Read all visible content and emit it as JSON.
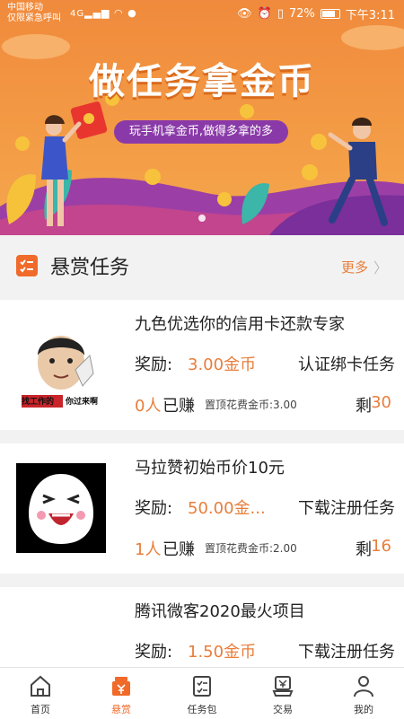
{
  "status_bar": {
    "carrier_line1": "中国移动",
    "carrier_line2": "仅限紧急呼叫",
    "signal_text": "4G",
    "battery": "72%",
    "time": "下午3:11"
  },
  "banner": {
    "title": "做任务拿金币",
    "subtitle": "玩手机拿金币,做得多拿的多"
  },
  "section": {
    "title": "悬赏任务",
    "more_label": "更多"
  },
  "tasks": [
    {
      "title": "九色优选你的信用卡还款专家",
      "reward_label": "奖励:",
      "reward_value": "3.00金币",
      "type": "认证绑卡任务",
      "earned_count": "0人",
      "earned_text": "已赚",
      "top_fee": "置顶花费金币:3.00",
      "remain_label": "剩",
      "remain_count": "30",
      "thumb_caption_left": "找工作的",
      "thumb_caption_right": "你过来啊"
    },
    {
      "title": "马拉赞初始币价10元",
      "reward_label": "奖励:",
      "reward_value": "50.00金...",
      "type": "下载注册任务",
      "earned_count": "1人",
      "earned_text": "已赚",
      "top_fee": "置顶花费金币:2.00",
      "remain_label": "剩",
      "remain_count": "16"
    },
    {
      "title": "腾讯微客2020最火项目",
      "reward_label": "奖励:",
      "reward_value": "1.50金币",
      "type": "下载注册任务"
    }
  ],
  "nav": [
    {
      "label": "首页",
      "icon": "home-icon"
    },
    {
      "label": "悬赏",
      "icon": "bounty-icon"
    },
    {
      "label": "任务包",
      "icon": "task-package-icon"
    },
    {
      "label": "交易",
      "icon": "trade-icon"
    },
    {
      "label": "我的",
      "icon": "profile-icon"
    }
  ],
  "colors": {
    "accent": "#e87e3b",
    "banner": "#f39a45",
    "pill": "#8a3aa8",
    "active_nav": "#f06a2a"
  }
}
